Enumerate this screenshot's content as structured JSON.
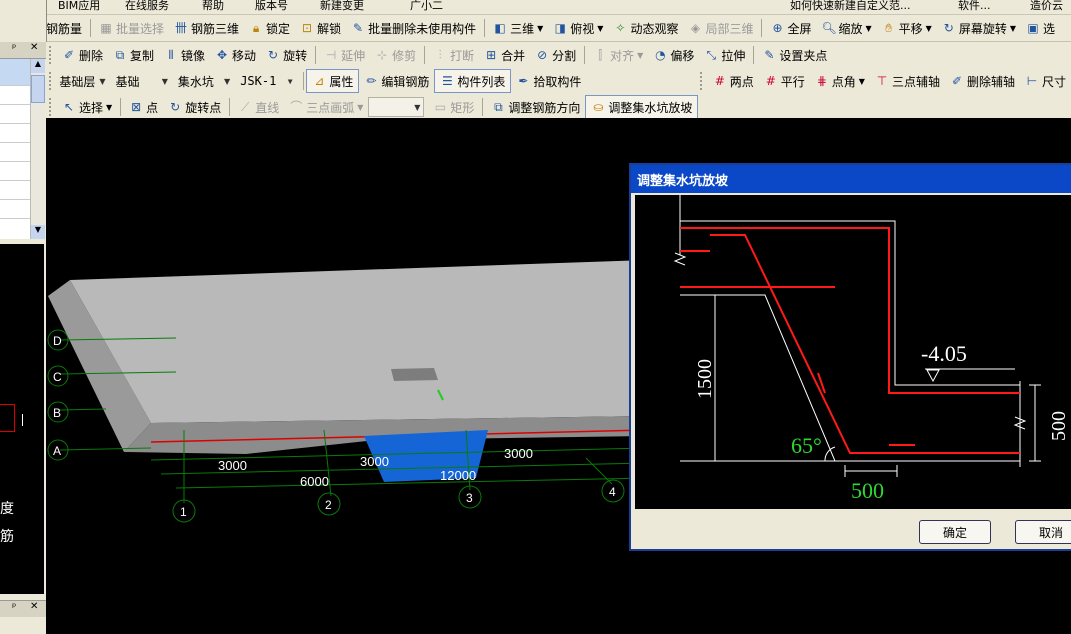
{
  "menubar": {
    "items": [
      "BIM应用",
      "在线服务",
      "帮助",
      "版本号"
    ],
    "new_change": "新建变更",
    "user": "广小二",
    "hint": "如何快速新建自定义范...",
    "search_value": "软件...",
    "right_text": "造价云"
  },
  "toolbar1": {
    "items": [
      "查看钢筋量",
      "批量选择",
      "钢筋三维",
      "锁定",
      "解锁",
      "批量删除未使用构件",
      "三维",
      "俯视",
      "动态观察",
      "局部三维",
      "全屏",
      "缩放",
      "平移",
      "屏幕旋转",
      "选"
    ]
  },
  "toolbar2": {
    "items": [
      "删除",
      "复制",
      "镜像",
      "移动",
      "旋转",
      "延伸",
      "修剪",
      "打断",
      "合并",
      "分割",
      "对齐",
      "偏移",
      "拉伸",
      "设置夹点"
    ]
  },
  "toolbar3": {
    "layer_combo": "基础层",
    "type_combo": "基础",
    "component_combo": "集水坑",
    "name_combo": "JSK-1",
    "items": [
      "属性",
      "编辑钢筋",
      "构件列表",
      "拾取构件",
      "两点",
      "平行",
      "点角",
      "三点辅轴",
      "删除辅轴",
      "尺寸"
    ]
  },
  "toolbar4": {
    "select": "选择",
    "items": [
      "点",
      "旋转点",
      "直线",
      "三点画弧",
      "矩形",
      "调整钢筋方向",
      "调整集水坑放坡"
    ]
  },
  "left_panel": {
    "text1": "度",
    "text2": "筋"
  },
  "canvas": {
    "axis_rows": [
      "D",
      "C",
      "B",
      "A"
    ],
    "axis_cols": [
      "1",
      "2",
      "3",
      "4"
    ],
    "dims": [
      "3000",
      "6000",
      "3000",
      "3000",
      "12000"
    ]
  },
  "dialog": {
    "title": "调整集水坑放坡",
    "elevation": "-4.05",
    "depth": "1500",
    "angle": "65°",
    "width": "500",
    "thickness": "500",
    "ok": "确定",
    "cancel": "取消"
  }
}
